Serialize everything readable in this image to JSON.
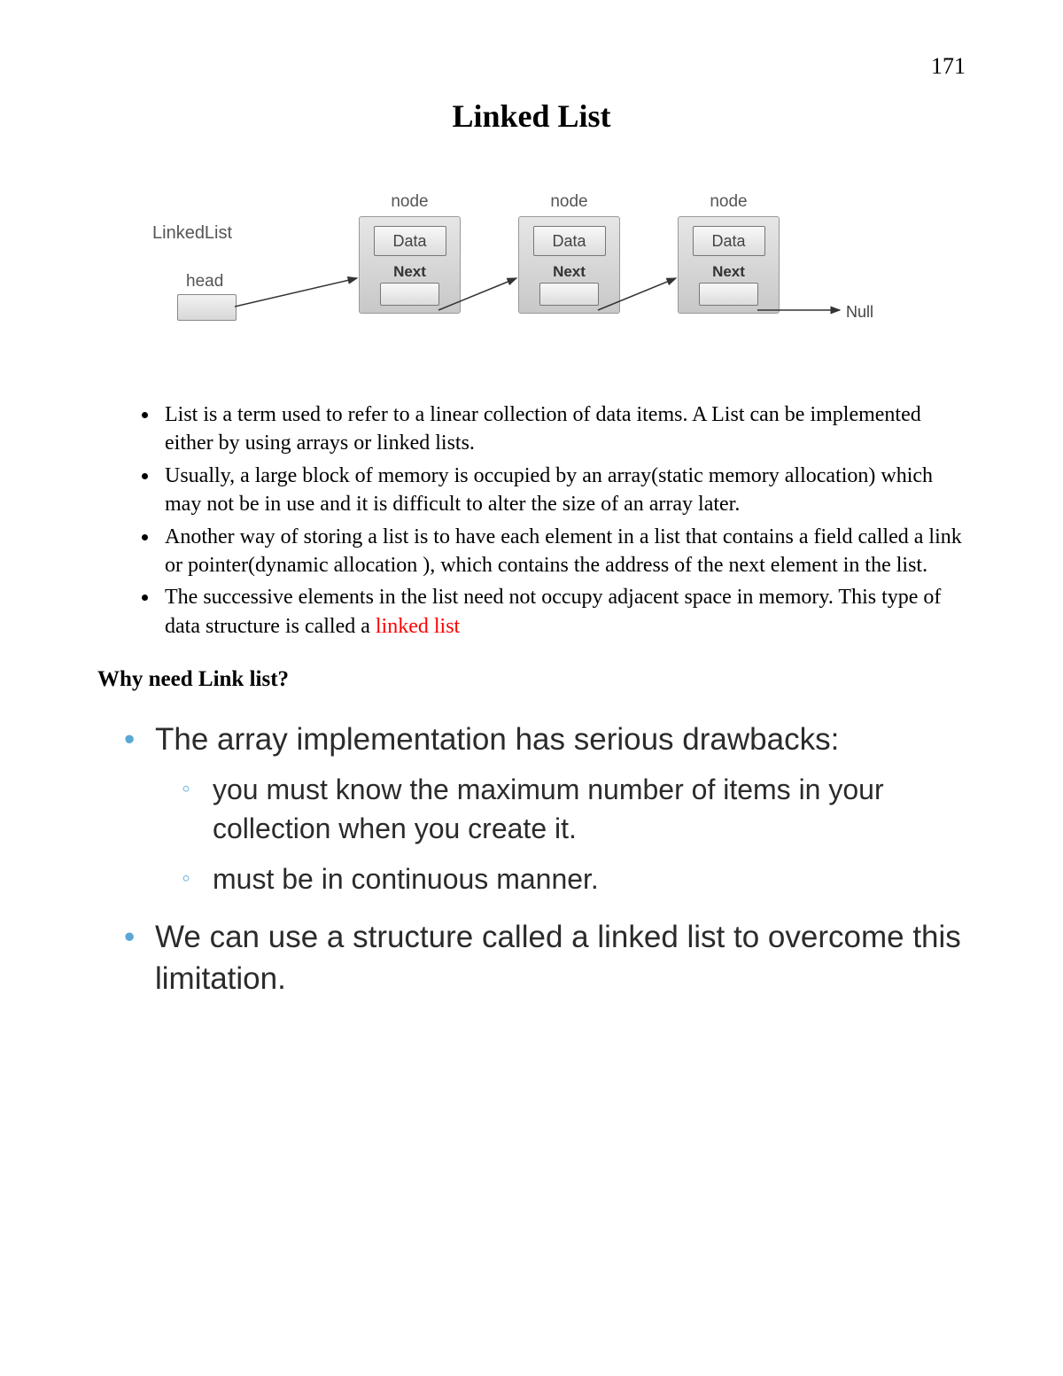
{
  "page_number": "171",
  "title": "Linked List",
  "diagram": {
    "linkedlist_label": "LinkedList",
    "head_label": "head",
    "node_label": "node",
    "data_label": "Data",
    "next_label": "Next",
    "null_label": "Null"
  },
  "bullets": [
    " List is a term used to refer to a linear collection of data items. A List can be implemented either by using arrays or linked lists.",
    "Usually, a large block of memory is occupied by an array(static memory allocation) which may not be in use and it is difficult to alter the size of an array later.",
    "Another way of storing a list is to have each element in a list that contains a field called a link or pointer(dynamic allocation ), which contains the address of the next element in the list."
  ],
  "bullet4_prefix": "The successive elements in the list need not occupy adjacent space in memory. This type of data structure is called a ",
  "bullet4_highlight": "linked list",
  "subheading": "Why need Link list?",
  "slide": {
    "item1": "The array implementation has serious drawbacks:",
    "item1_sub1": "you must know the maximum number of items in your collection when you create it.",
    "item1_sub2": "must be in continuous manner.",
    "item2": "We can use a structure called a linked list to overcome this limitation."
  }
}
